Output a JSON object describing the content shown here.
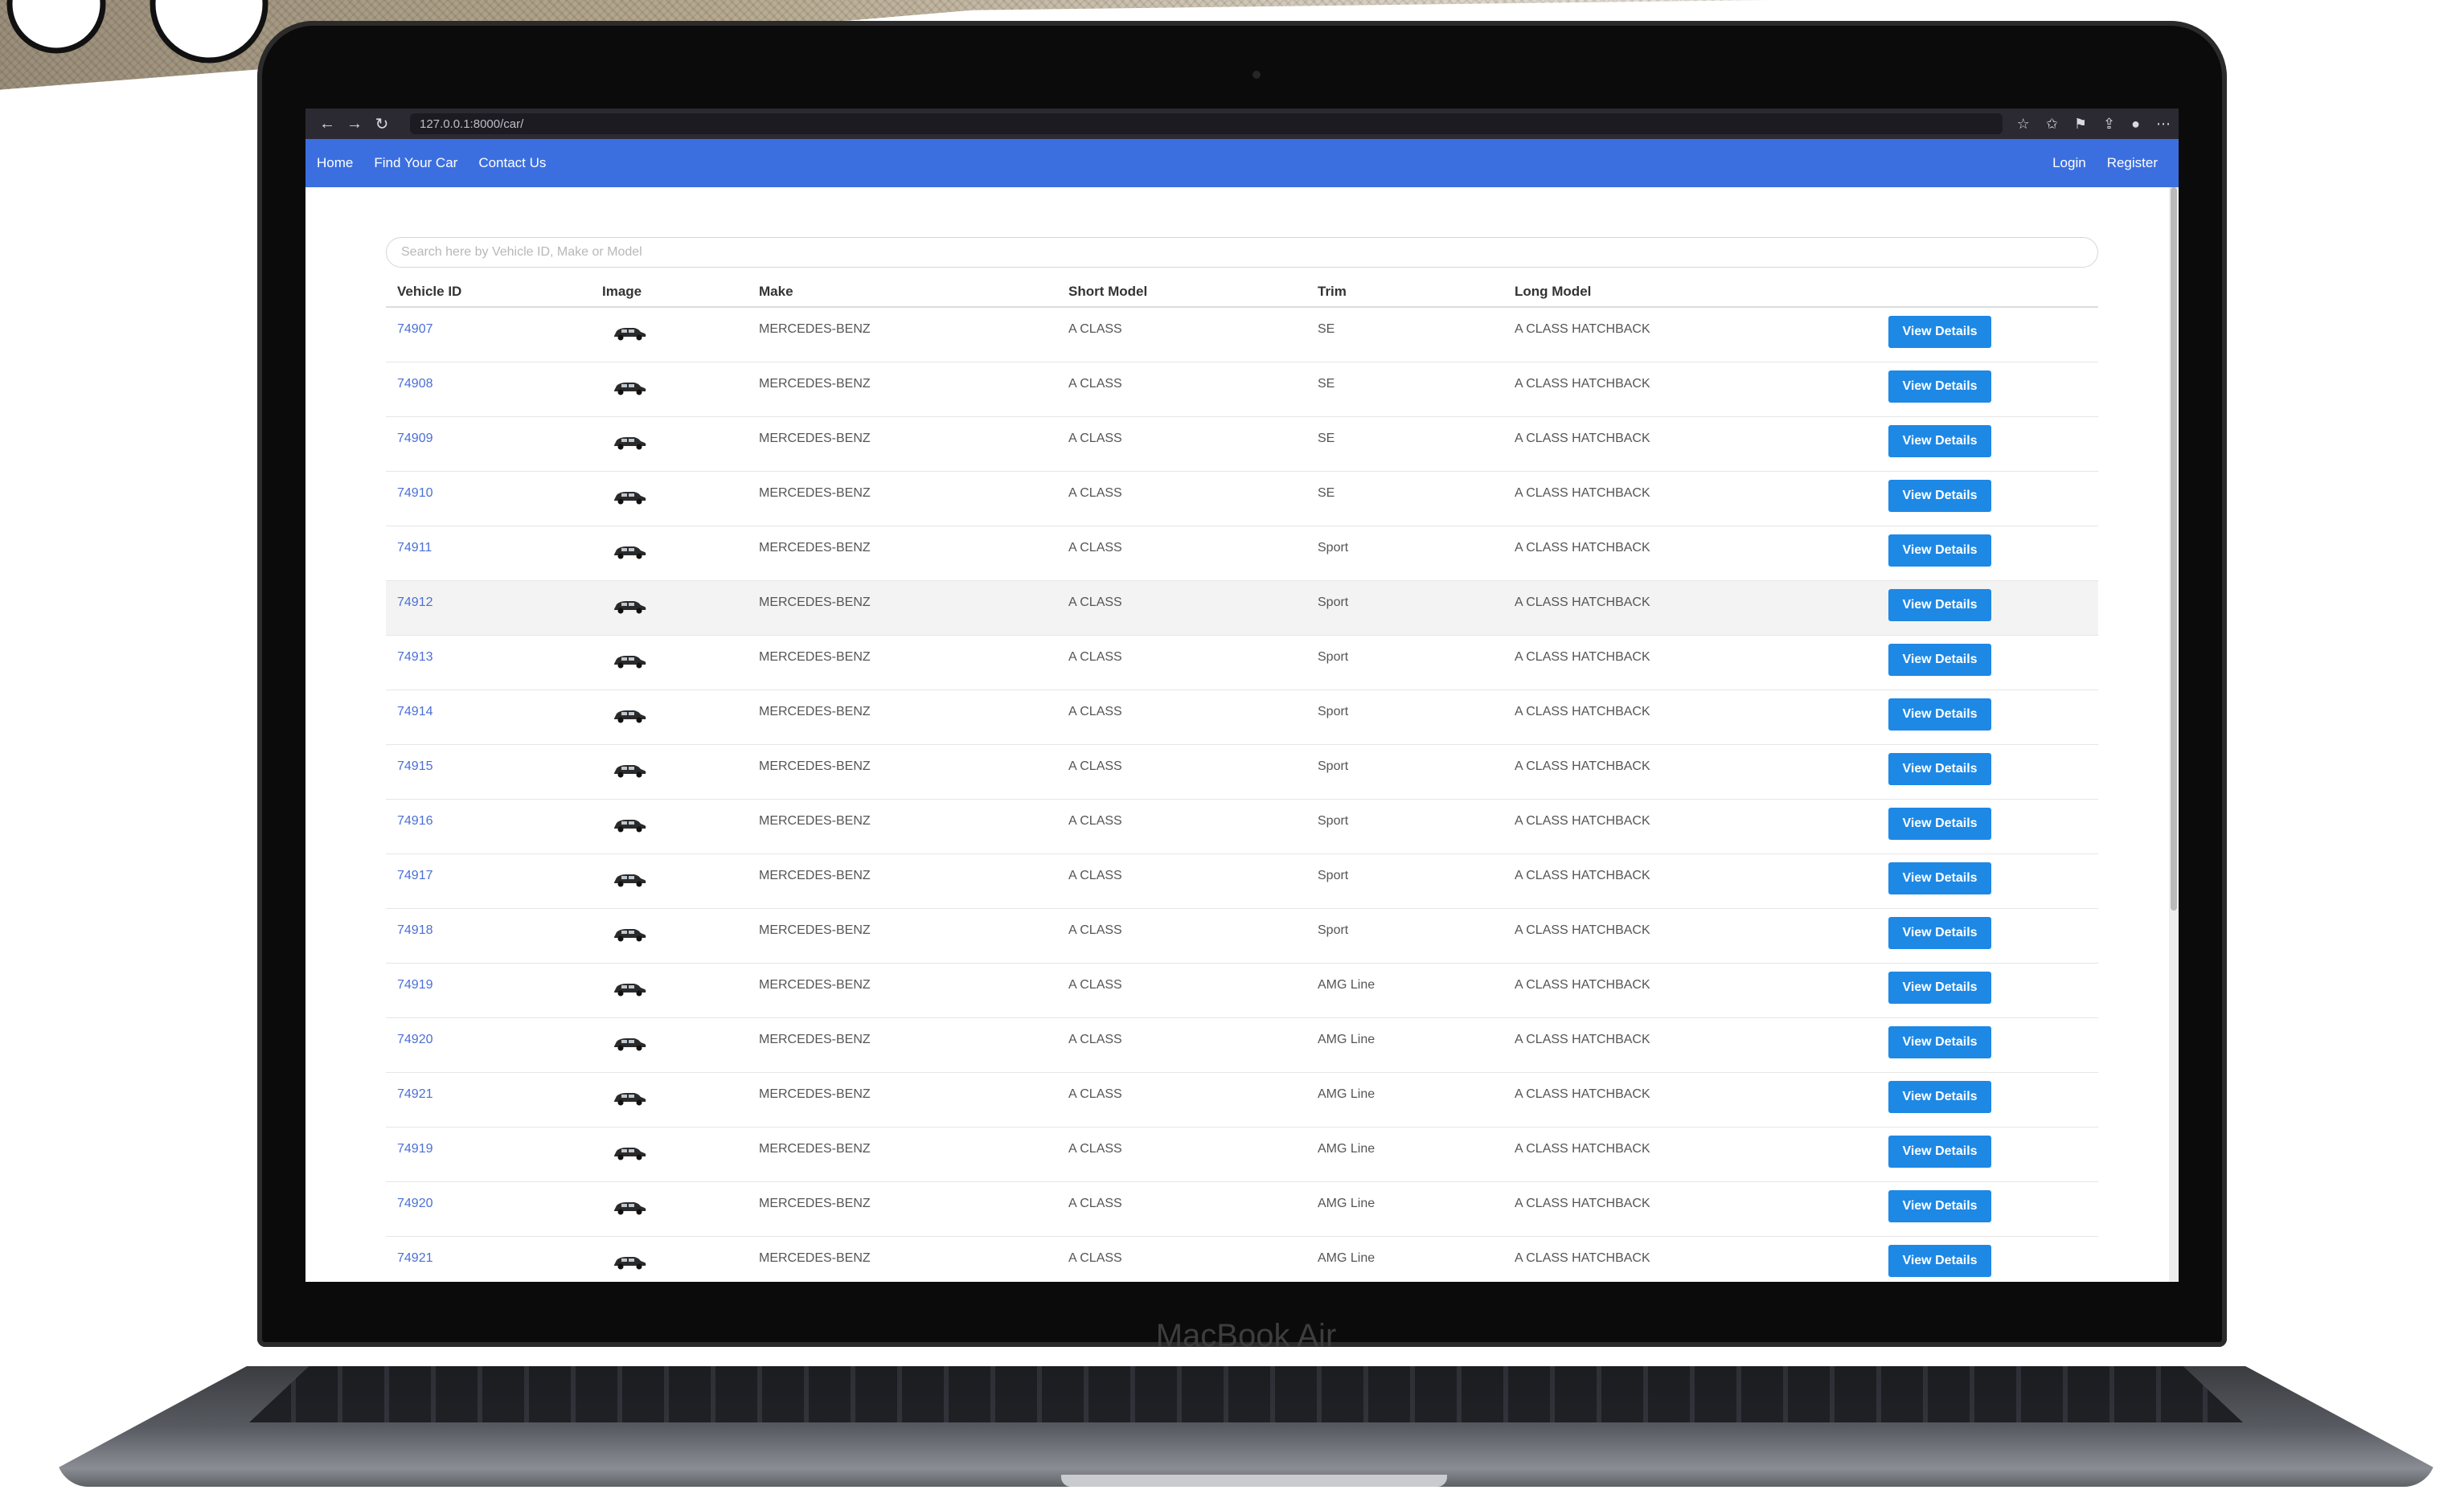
{
  "browser": {
    "url": "127.0.0.1:8000/car/",
    "back_icon": "←",
    "forward_icon": "→",
    "reload_icon": "↻"
  },
  "nav": {
    "left": [
      "Home",
      "Find Your Car",
      "Contact Us"
    ],
    "right": [
      "Login",
      "Register"
    ]
  },
  "search": {
    "placeholder": "Search here by Vehicle ID, Make or Model"
  },
  "table": {
    "headers": [
      "Vehicle ID",
      "Image",
      "Make",
      "Short Model",
      "Trim",
      "Long Model",
      ""
    ],
    "button_label": "View Details",
    "rows": [
      {
        "id": "74907",
        "make": "MERCEDES-BENZ",
        "short_model": "A CLASS",
        "trim": "SE",
        "long_model": "A CLASS HATCHBACK"
      },
      {
        "id": "74908",
        "make": "MERCEDES-BENZ",
        "short_model": "A CLASS",
        "trim": "SE",
        "long_model": "A CLASS HATCHBACK"
      },
      {
        "id": "74909",
        "make": "MERCEDES-BENZ",
        "short_model": "A CLASS",
        "trim": "SE",
        "long_model": "A CLASS HATCHBACK"
      },
      {
        "id": "74910",
        "make": "MERCEDES-BENZ",
        "short_model": "A CLASS",
        "trim": "SE",
        "long_model": "A CLASS HATCHBACK"
      },
      {
        "id": "74911",
        "make": "MERCEDES-BENZ",
        "short_model": "A CLASS",
        "trim": "Sport",
        "long_model": "A CLASS HATCHBACK"
      },
      {
        "id": "74912",
        "make": "MERCEDES-BENZ",
        "short_model": "A CLASS",
        "trim": "Sport",
        "long_model": "A CLASS HATCHBACK",
        "highlight": true
      },
      {
        "id": "74913",
        "make": "MERCEDES-BENZ",
        "short_model": "A CLASS",
        "trim": "Sport",
        "long_model": "A CLASS HATCHBACK"
      },
      {
        "id": "74914",
        "make": "MERCEDES-BENZ",
        "short_model": "A CLASS",
        "trim": "Sport",
        "long_model": "A CLASS HATCHBACK"
      },
      {
        "id": "74915",
        "make": "MERCEDES-BENZ",
        "short_model": "A CLASS",
        "trim": "Sport",
        "long_model": "A CLASS HATCHBACK"
      },
      {
        "id": "74916",
        "make": "MERCEDES-BENZ",
        "short_model": "A CLASS",
        "trim": "Sport",
        "long_model": "A CLASS HATCHBACK"
      },
      {
        "id": "74917",
        "make": "MERCEDES-BENZ",
        "short_model": "A CLASS",
        "trim": "Sport",
        "long_model": "A CLASS HATCHBACK"
      },
      {
        "id": "74918",
        "make": "MERCEDES-BENZ",
        "short_model": "A CLASS",
        "trim": "Sport",
        "long_model": "A CLASS HATCHBACK"
      },
      {
        "id": "74919",
        "make": "MERCEDES-BENZ",
        "short_model": "A CLASS",
        "trim": "AMG Line",
        "long_model": "A CLASS HATCHBACK"
      },
      {
        "id": "74920",
        "make": "MERCEDES-BENZ",
        "short_model": "A CLASS",
        "trim": "AMG Line",
        "long_model": "A CLASS HATCHBACK"
      },
      {
        "id": "74921",
        "make": "MERCEDES-BENZ",
        "short_model": "A CLASS",
        "trim": "AMG Line",
        "long_model": "A CLASS HATCHBACK"
      },
      {
        "id": "74919",
        "make": "MERCEDES-BENZ",
        "short_model": "A CLASS",
        "trim": "AMG Line",
        "long_model": "A CLASS HATCHBACK"
      },
      {
        "id": "74920",
        "make": "MERCEDES-BENZ",
        "short_model": "A CLASS",
        "trim": "AMG Line",
        "long_model": "A CLASS HATCHBACK"
      },
      {
        "id": "74921",
        "make": "MERCEDES-BENZ",
        "short_model": "A CLASS",
        "trim": "AMG Line",
        "long_model": "A CLASS HATCHBACK"
      }
    ]
  },
  "device": {
    "label": "MacBook Air"
  },
  "colors": {
    "nav_bg": "#3b6fe0",
    "button_bg": "#1e88e5",
    "link": "#4b6fd6"
  }
}
